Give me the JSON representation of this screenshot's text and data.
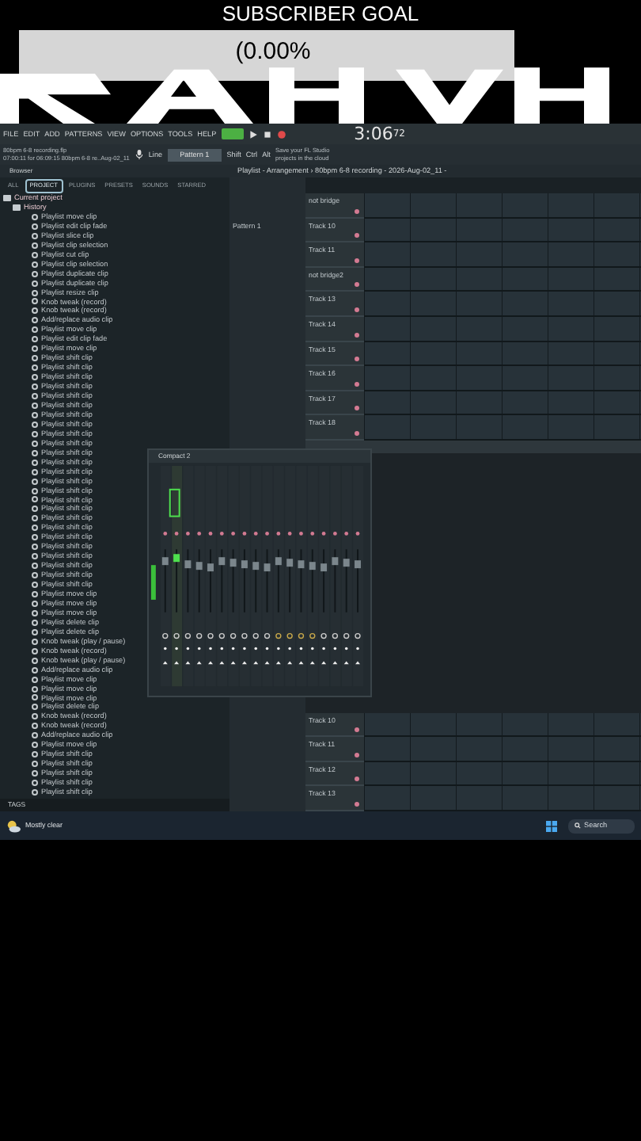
{
  "overlay": {
    "title": "SUBSCRIBER GOAL",
    "progress": "(0.00%",
    "level": 0
  },
  "song_mode": true,
  "menu": [
    "FILE",
    "EDIT",
    "ADD",
    "PATTERNS",
    "VIEW",
    "OPTIONS",
    "TOOLS",
    "HELP"
  ],
  "transport": {
    "time": "3:06",
    "time_fraction": "72"
  },
  "project_info": [
    "80bpm 6-8 recording.flp",
    "07:00:11 for 06:09:15 80bpm 6-8 re..Aug-02_11"
  ],
  "snap": "Line",
  "pattern": "Pattern 1",
  "modifiers": [
    "Shift",
    "Ctrl",
    "Alt"
  ],
  "hint": "Save your FL Studio projects in the cloud",
  "browser": {
    "title": "Browser",
    "tabs": [
      {
        "label": "ALL",
        "selected": false
      },
      {
        "label": "PROJECT",
        "selected": true
      },
      {
        "label": "PLUGINS",
        "selected": false
      },
      {
        "label": "PRESETS",
        "selected": false
      },
      {
        "label": "SOUNDS",
        "selected": false
      },
      {
        "label": "STARRED",
        "selected": false
      }
    ],
    "tree": [
      {
        "label": "Current project",
        "children": [
          {
            "label": "History",
            "children": [
              {
                "label": "Playlist move clip"
              },
              {
                "label": "Playlist edit clip fade"
              },
              {
                "label": "Playlist slice clip"
              },
              {
                "label": "Playlist clip selection"
              },
              {
                "label": "Playlist cut clip"
              },
              {
                "label": "Playlist clip selection"
              },
              {
                "label": "Playlist duplicate clip"
              },
              {
                "label": "Playlist duplicate clip"
              },
              {
                "label": "Playlist resize clip"
              },
              {
                "label": "Knob tweak (record)"
              },
              {
                "label": "Knob tweak (record)"
              },
              {
                "label": "Add/replace audio clip"
              },
              {
                "label": "Playlist move clip"
              },
              {
                "label": "Playlist edit clip fade"
              },
              {
                "label": "Playlist move clip"
              },
              {
                "label": "Playlist shift clip"
              },
              {
                "label": "Playlist shift clip"
              },
              {
                "label": "Playlist shift clip"
              },
              {
                "label": "Playlist shift clip"
              },
              {
                "label": "Playlist shift clip"
              },
              {
                "label": "Playlist shift clip"
              },
              {
                "label": "Playlist shift clip"
              },
              {
                "label": "Playlist shift clip"
              },
              {
                "label": "Playlist shift clip"
              },
              {
                "label": "Playlist shift clip"
              },
              {
                "label": "Playlist shift clip"
              },
              {
                "label": "Playlist shift clip"
              },
              {
                "label": "Playlist shift clip"
              },
              {
                "label": "Playlist shift clip"
              },
              {
                "label": "Playlist shift clip"
              },
              {
                "label": "Playlist shift clip"
              },
              {
                "label": "Playlist shift clip"
              },
              {
                "label": "Playlist shift clip"
              },
              {
                "label": "Playlist shift clip"
              },
              {
                "label": "Playlist shift clip"
              },
              {
                "label": "Playlist shift clip"
              },
              {
                "label": "Playlist shift clip"
              },
              {
                "label": "Playlist shift clip"
              },
              {
                "label": "Playlist shift clip"
              },
              {
                "label": "Playlist shift clip"
              },
              {
                "label": "Playlist move clip"
              },
              {
                "label": "Playlist move clip"
              },
              {
                "label": "Playlist move clip"
              },
              {
                "label": "Playlist delete clip"
              },
              {
                "label": "Playlist delete clip"
              },
              {
                "label": "Knob tweak (play / pause)"
              },
              {
                "label": "Knob tweak (record)"
              },
              {
                "label": "Knob tweak (play / pause)"
              },
              {
                "label": "Add/replace audio clip"
              },
              {
                "label": "Playlist move clip"
              },
              {
                "label": "Playlist move clip"
              },
              {
                "label": "Playlist move clip"
              },
              {
                "label": "Playlist delete clip"
              },
              {
                "label": "Knob tweak (record)"
              },
              {
                "label": "Knob tweak (record)"
              },
              {
                "label": "Add/replace audio clip"
              },
              {
                "label": "Playlist move clip"
              },
              {
                "label": "Playlist shift clip"
              },
              {
                "label": "Playlist shift clip"
              },
              {
                "label": "Playlist shift clip"
              },
              {
                "label": "Playlist shift clip"
              },
              {
                "label": "Playlist shift clip"
              }
            ]
          }
        ]
      }
    ],
    "footer": "TAGS"
  },
  "playlist": {
    "title": "Playlist - Arrangement › 80bpm 6-8 recording - 2026-Aug-02_11 -",
    "pattern": "Pattern 1",
    "tracks": [
      "not bridge",
      "Track 10",
      "Track 11",
      "not bridge2",
      "Track 13",
      "Track 14",
      "Track 15",
      "Track 16",
      "Track 17",
      "Track 18"
    ],
    "lower_tracks": [
      "Track 10",
      "Track 11",
      "Track 12",
      "Track 13"
    ]
  },
  "mixer": {
    "title": "Compact 2"
  },
  "taskbar": {
    "weather": "Mostly clear",
    "search": "Search"
  }
}
